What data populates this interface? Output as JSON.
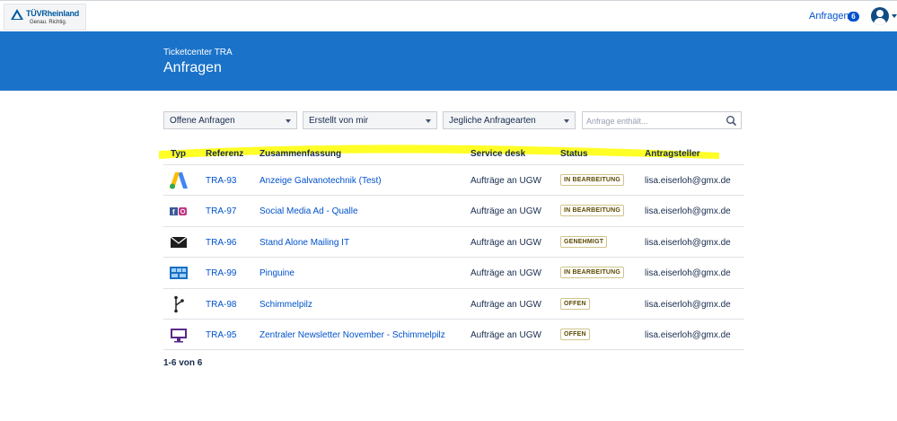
{
  "header": {
    "logo_brand": "TÜVRheinland",
    "logo_tagline": "Genau. Richtig.",
    "nav_label": "Anfragen",
    "nav_badge": "6"
  },
  "banner": {
    "subtitle": "Ticketcenter TRA",
    "title": "Anfragen"
  },
  "filters": {
    "status": "Offene Anfragen",
    "creator": "Erstellt von mir",
    "type": "Jegliche Anfragearten",
    "search_placeholder": "Anfrage enthält..."
  },
  "columns": {
    "typ": "Typ",
    "referenz": "Referenz",
    "zusammenfassung": "Zusammenfassung",
    "service_desk": "Service desk",
    "status": "Status",
    "antragsteller": "Antragsteller"
  },
  "rows": [
    {
      "icon": "google-ads-icon",
      "ref": "TRA-93",
      "summary": "Anzeige Galvanotechnik (Test)",
      "desk": "Aufträge an UGW",
      "status": "IN BEARBEITUNG",
      "requester": "lisa.eiserloh@gmx.de"
    },
    {
      "icon": "social-media-icon",
      "ref": "TRA-97",
      "summary": "Social Media Ad - Qualle",
      "desk": "Aufträge an UGW",
      "status": "IN BEARBEITUNG",
      "requester": "lisa.eiserloh@gmx.de"
    },
    {
      "icon": "envelope-icon",
      "ref": "TRA-96",
      "summary": "Stand Alone Mailing IT",
      "desk": "Aufträge an UGW",
      "status": "GENEHMIGT",
      "requester": "lisa.eiserloh@gmx.de"
    },
    {
      "icon": "banner-ad-icon",
      "ref": "TRA-99",
      "summary": "Pinguine",
      "desk": "Aufträge an UGW",
      "status": "IN BEARBEITUNG",
      "requester": "lisa.eiserloh@gmx.de"
    },
    {
      "icon": "branch-icon",
      "ref": "TRA-98",
      "summary": "Schimmelpilz",
      "desk": "Aufträge an UGW",
      "status": "OFFEN",
      "requester": "lisa.eiserloh@gmx.de"
    },
    {
      "icon": "monitor-icon",
      "ref": "TRA-95",
      "summary": "Zentraler Newsletter November - Schimmelpilz",
      "desk": "Aufträge an UGW",
      "status": "OFFEN",
      "requester": "lisa.eiserloh@gmx.de"
    }
  ],
  "pagination": {
    "count_text": "1-6 von 6"
  },
  "colors": {
    "banner": "#1a73c9",
    "link": "#0052cc",
    "highlight": "#ffff00"
  }
}
